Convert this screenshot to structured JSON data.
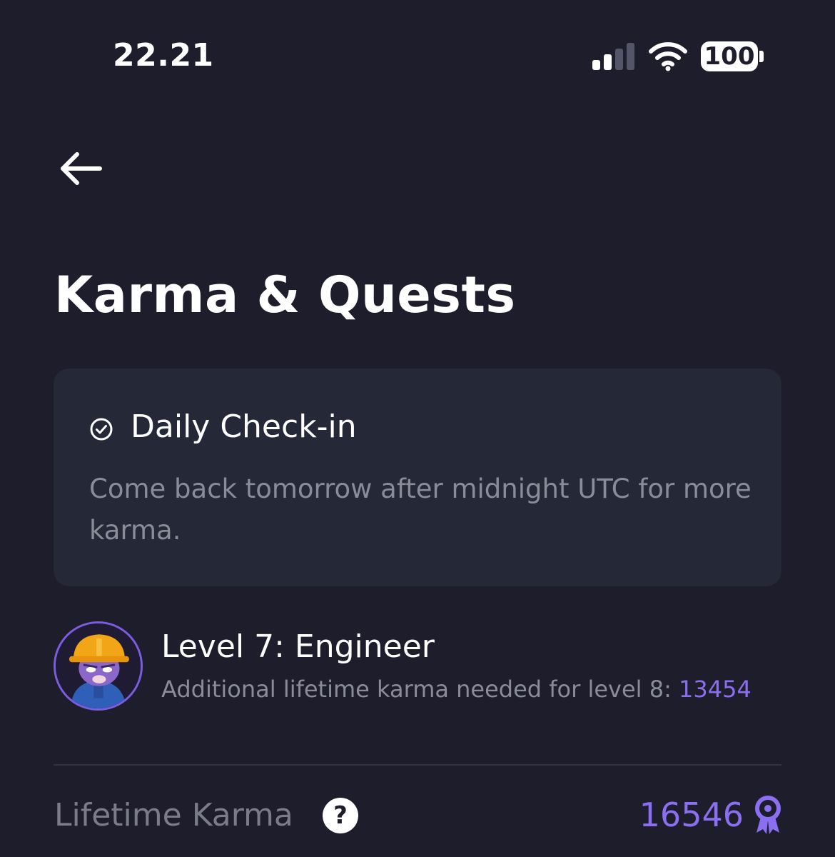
{
  "status_bar": {
    "time": "22.21",
    "battery": "100",
    "signal_icon": "cellular-signal-icon",
    "wifi_icon": "wifi-icon"
  },
  "nav": {
    "back_icon": "arrow-left-icon"
  },
  "page": {
    "title": "Karma & Quests"
  },
  "daily_checkin": {
    "icon": "check-circle-icon",
    "title": "Daily Check-in",
    "description": "Come back tomorrow after midnight UTC for more karma."
  },
  "level": {
    "title": "Level 7: Engineer",
    "subtitle_prefix": "Additional lifetime karma needed for level 8: ",
    "karma_needed": "13454"
  },
  "lifetime_karma": {
    "label": "Lifetime Karma",
    "help_icon": "question-icon",
    "help_glyph": "?",
    "value": "16546",
    "value_icon": "award-ribbon-icon"
  },
  "colors": {
    "background": "#1e1d2b",
    "card": "#252836",
    "accent": "#8b6ff0",
    "muted_text": "#8a8d99"
  }
}
